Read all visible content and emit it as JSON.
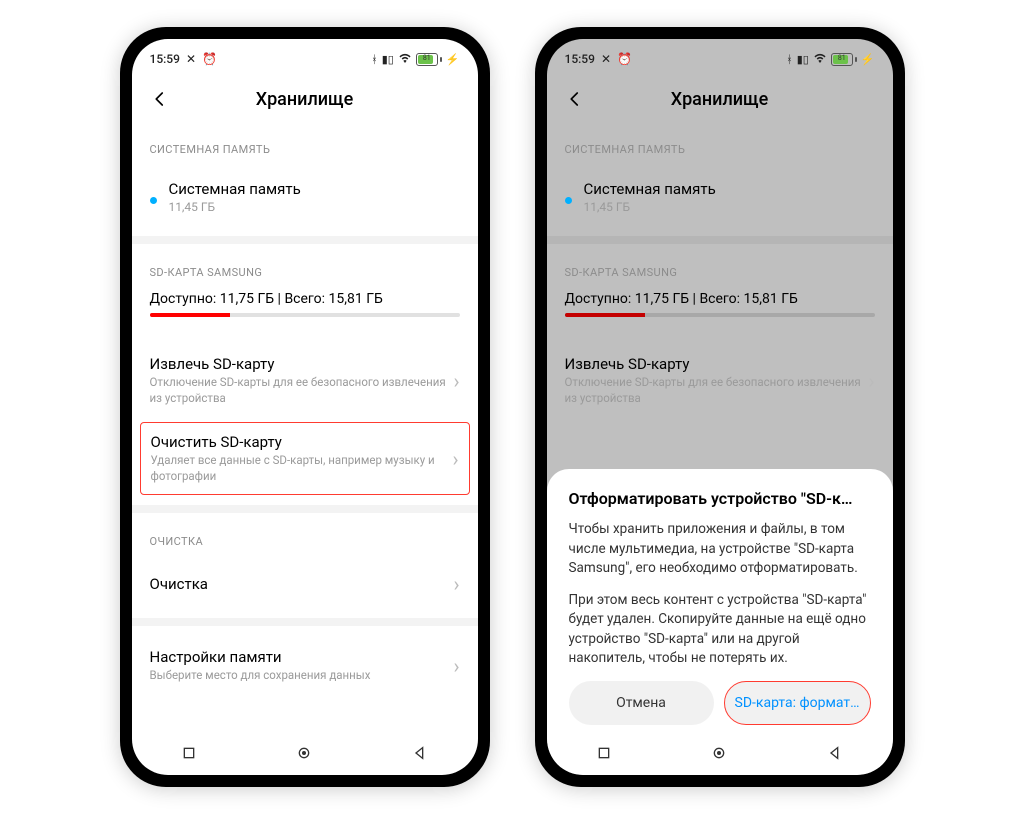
{
  "status": {
    "time": "15:59",
    "battery_pct": "81"
  },
  "header": {
    "title": "Хранилище"
  },
  "sections": {
    "sys_label": "СИСТЕМНАЯ ПАМЯТЬ",
    "sd_label": "SD-КАРТА SAMSUNG",
    "cleanup_label": "ОЧИСТКА"
  },
  "sysmem": {
    "title": "Системная память",
    "size": "11,45 ГБ"
  },
  "sd": {
    "available_line": "Доступно: 11,75 ГБ | Всего: 15,81 ГБ",
    "used_pct": 26,
    "eject_title": "Извлечь SD-карту",
    "eject_sub": "Отключение SD-карты для ее безопасного извлечения из устройства",
    "clear_title": "Очистить SD-карту",
    "clear_sub": "Удаляет все данные с SD-карты, например музыку и фотографии"
  },
  "cleanup": {
    "title": "Очистка"
  },
  "memory_settings": {
    "title": "Настройки памяти",
    "sub": "Выберите место для сохранения данных"
  },
  "dialog": {
    "title": "Отформатировать устройство \"SD-к…",
    "body1": "Чтобы хранить приложения и файлы, в том числе мультимедиа, на устройстве \"SD-карта Samsung\", его необходимо отформатировать.",
    "body2": "При этом весь контент с устройства \"SD-карта\" будет удален. Скопируйте данные на ещё одно устройство \"SD-карта\" или на другой накопитель, чтобы не потерять их.",
    "cancel": "Отмена",
    "confirm": "SD-карта: формат…"
  }
}
